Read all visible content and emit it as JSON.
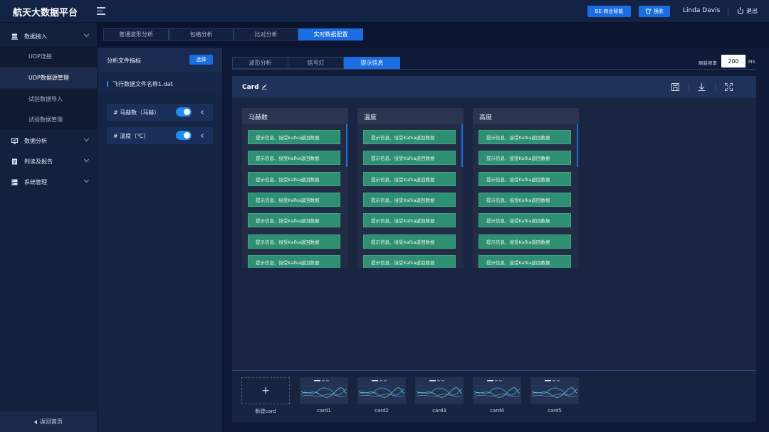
{
  "app": {
    "title": "航天大数据平台"
  },
  "header": {
    "bi_button": "BE-商业智能",
    "skin_button": "换肤",
    "user_name": "Linda Davis",
    "logout_label": "退出"
  },
  "sidebar": {
    "groups": [
      {
        "label": "数据接入",
        "icon": "database-icon"
      },
      {
        "label": "数据分析",
        "icon": "chart-icon"
      },
      {
        "label": "判读及报告",
        "icon": "report-icon"
      },
      {
        "label": "系统管理",
        "icon": "system-icon"
      }
    ],
    "sub_items": [
      {
        "label": "UDP连接"
      },
      {
        "label": "UDP数据源管理",
        "active": true
      },
      {
        "label": "试验数据导入"
      },
      {
        "label": "试验数据管理"
      }
    ],
    "back_home": "返回首页"
  },
  "top_tabs": [
    {
      "label": "普通波形分析"
    },
    {
      "label": "包络分析"
    },
    {
      "label": "比对分析"
    },
    {
      "label": "实时数据配置",
      "active": true
    }
  ],
  "middle": {
    "title": "分析文件指标",
    "choose_button": "选择",
    "file_name": "飞行数据文件名称1.dat",
    "metrics": [
      {
        "label": "# 马赫数（马赫）",
        "enabled": true
      },
      {
        "label": "# 温度（℃）",
        "enabled": true
      }
    ]
  },
  "main": {
    "sub_tabs": [
      {
        "label": "波形分析"
      },
      {
        "label": "信号灯"
      },
      {
        "label": "提示信息",
        "active": true
      }
    ],
    "refresh": {
      "label": "刷新频率",
      "value": "200",
      "unit": "MS"
    },
    "card": {
      "title": "Card",
      "columns": [
        {
          "title": "马赫数",
          "messages": [
            "提示信息、接受Kafka返回数据",
            "提示信息、接受Kafka返回数据",
            "提示信息、接受Kafka返回数据",
            "提示信息、接受Kafka返回数据",
            "提示信息、接受Kafka返回数据",
            "提示信息、接受Kafka返回数据",
            "提示信息、接受Kafka返回数据"
          ]
        },
        {
          "title": "温度",
          "messages": [
            "提示信息、接受Kafka返回数据",
            "提示信息、接受Kafka返回数据",
            "提示信息、接受Kafka返回数据",
            "提示信息、接受Kafka返回数据",
            "提示信息、接受Kafka返回数据",
            "提示信息、接受Kafka返回数据",
            "提示信息、接受Kafka返回数据"
          ]
        },
        {
          "title": "高度",
          "messages": [
            "提示信息、接受Kafka返回数据",
            "提示信息、接受Kafka返回数据",
            "提示信息、接受Kafka返回数据",
            "提示信息、接受Kafka返回数据",
            "提示信息、接受Kafka返回数据",
            "提示信息、接受Kafka返回数据",
            "提示信息、接受Kafka返回数据"
          ]
        }
      ]
    },
    "thumbnails": {
      "new_card_label": "新建card",
      "new_card_symbol": "+",
      "cards": [
        "card1",
        "card2",
        "card3",
        "card4",
        "card5"
      ]
    }
  },
  "colors": {
    "accent": "#1b6ee0",
    "message_green": "#2f8f73",
    "background": "#0b1530"
  }
}
